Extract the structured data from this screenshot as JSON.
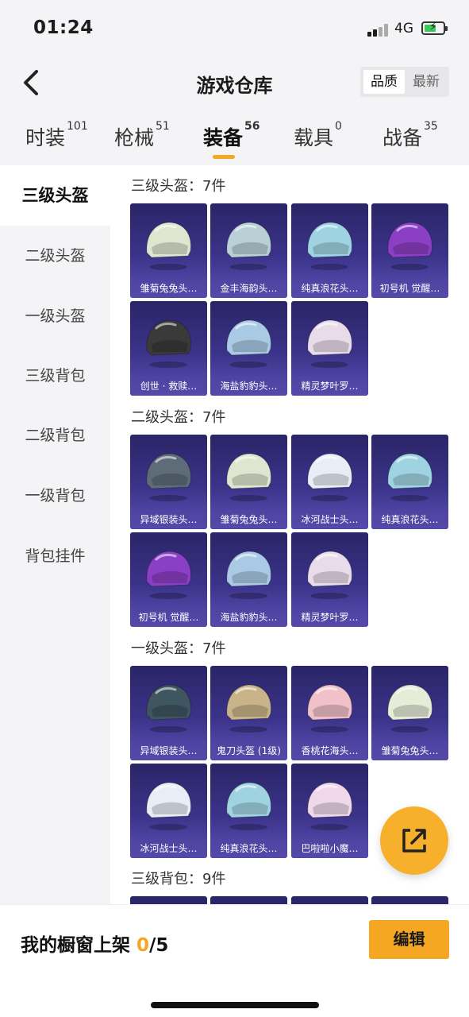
{
  "status": {
    "time": "01:24",
    "network": "4G"
  },
  "nav": {
    "title": "游戏仓库",
    "sort_quality": "品质",
    "sort_latest": "最新"
  },
  "tabs": [
    {
      "label": "时装",
      "count": "101"
    },
    {
      "label": "枪械",
      "count": "51"
    },
    {
      "label": "装备",
      "count": "56"
    },
    {
      "label": "载具",
      "count": "0"
    },
    {
      "label": "战备",
      "count": "35"
    }
  ],
  "sidebar": [
    "三级头盔",
    "二级头盔",
    "一级头盔",
    "三级背包",
    "二级背包",
    "一级背包",
    "背包挂件"
  ],
  "sections": [
    {
      "title": "三级头盔：7件",
      "items": [
        {
          "name": "雏菊兔兔头…",
          "color": "#dfe6cf"
        },
        {
          "name": "金丰海韵头…",
          "color": "#b9d0d6"
        },
        {
          "name": "纯真浪花头…",
          "color": "#9fd3e2"
        },
        {
          "name": "初号机 觉醒…",
          "color": "#8b3fc4"
        },
        {
          "name": "创世 · 救赎…",
          "color": "#3a3a3a"
        },
        {
          "name": "海盐豹豹头…",
          "color": "#a9c9e4"
        },
        {
          "name": "精灵梦叶罗…",
          "color": "#e9dcea"
        }
      ]
    },
    {
      "title": "二级头盔：7件",
      "items": [
        {
          "name": "异域银装头…",
          "color": "#5d6c78"
        },
        {
          "name": "雏菊兔兔头…",
          "color": "#dfe6cf"
        },
        {
          "name": "冰河战士头…",
          "color": "#e8eef6"
        },
        {
          "name": "纯真浪花头…",
          "color": "#9fd3e2"
        },
        {
          "name": "初号机 觉醒…",
          "color": "#8b3fc4"
        },
        {
          "name": "海盐豹豹头…",
          "color": "#a9c9e4"
        },
        {
          "name": "精灵梦叶罗…",
          "color": "#e9dcea"
        }
      ]
    },
    {
      "title": "一级头盔：7件",
      "items": [
        {
          "name": "异域银装头…",
          "color": "#3f5560"
        },
        {
          "name": "鬼刀头盔 (1级)",
          "color": "#c9b48a"
        },
        {
          "name": "香桃花海头…",
          "color": "#f1c0c8"
        },
        {
          "name": "雏菊兔兔头…",
          "color": "#e6ecd8"
        },
        {
          "name": "冰河战士头…",
          "color": "#e8eef6"
        },
        {
          "name": "纯真浪花头…",
          "color": "#9fd3e2"
        },
        {
          "name": "巴啦啦小魔…",
          "color": "#f0d8ea"
        }
      ]
    },
    {
      "title": "三级背包：9件",
      "items": []
    }
  ],
  "bottom": {
    "showcase_label": "我的橱窗上架 ",
    "showcase_count": "0",
    "showcase_total": "/5",
    "edit_label": "编辑"
  }
}
